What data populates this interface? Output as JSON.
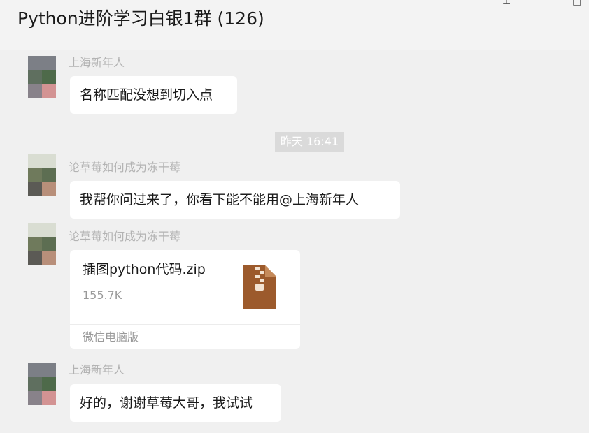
{
  "chat": {
    "title": "Python进阶学习白银1群 (126)",
    "window_controls": [
      "pin-icon",
      "close-icon"
    ]
  },
  "messages": [
    {
      "sender": "上海新年人",
      "type": "text",
      "text": "名称匹配没想到切入点"
    },
    {
      "type": "timestamp",
      "text": "昨天 16:41"
    },
    {
      "sender": "论草莓如何成为冻干莓",
      "type": "text",
      "text": "我帮你问过来了，你看下能不能用@上海新年人"
    },
    {
      "sender": "论草莓如何成为冻干莓",
      "type": "file",
      "file": {
        "name": "插图python代码.zip",
        "size": "155.7K",
        "source": "微信电脑版",
        "icon": "zip-file-icon",
        "icon_color": "#9c5a2c"
      }
    },
    {
      "sender": "上海新年人",
      "type": "text",
      "text": "好的，谢谢草莓大哥，我试试"
    }
  ],
  "colors": {
    "background": "#f0f0f0",
    "bubble": "#ffffff",
    "sender_name": "#b3b3b3",
    "timestamp_bg": "#dadada"
  }
}
